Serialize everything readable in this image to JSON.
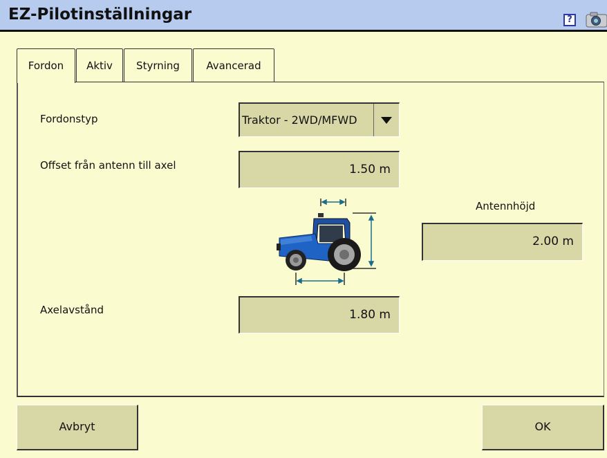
{
  "window": {
    "title": "EZ-Pilotinställningar",
    "help_glyph": "?"
  },
  "tabs": [
    {
      "label": "Fordon",
      "active": true
    },
    {
      "label": "Aktiv",
      "active": false
    },
    {
      "label": "Styrning",
      "active": false
    },
    {
      "label": "Avancerad",
      "active": false
    }
  ],
  "form": {
    "vehicle_type": {
      "label": "Fordonstyp",
      "value": "Traktor - 2WD/MFWD"
    },
    "antenna_offset": {
      "label": "Offset från antenn till axel",
      "value": "1.50 m"
    },
    "antenna_height": {
      "label": "Antennhöjd",
      "value": "2.00 m"
    },
    "wheelbase": {
      "label": "Axelavstånd",
      "value": "1.80 m"
    }
  },
  "buttons": {
    "cancel": "Avbryt",
    "ok": "OK"
  },
  "colors": {
    "background": "#fbfbd0",
    "titlebar": "#b7cbee",
    "field": "#d8d7a6",
    "tractor_body": "#1f63c4",
    "dimension_arrows": "#1a6c8c"
  },
  "icons": {
    "help": "help-icon",
    "camera": "camera-icon",
    "dropdown": "chevron-down-icon",
    "illustration": "tractor-diagram"
  }
}
